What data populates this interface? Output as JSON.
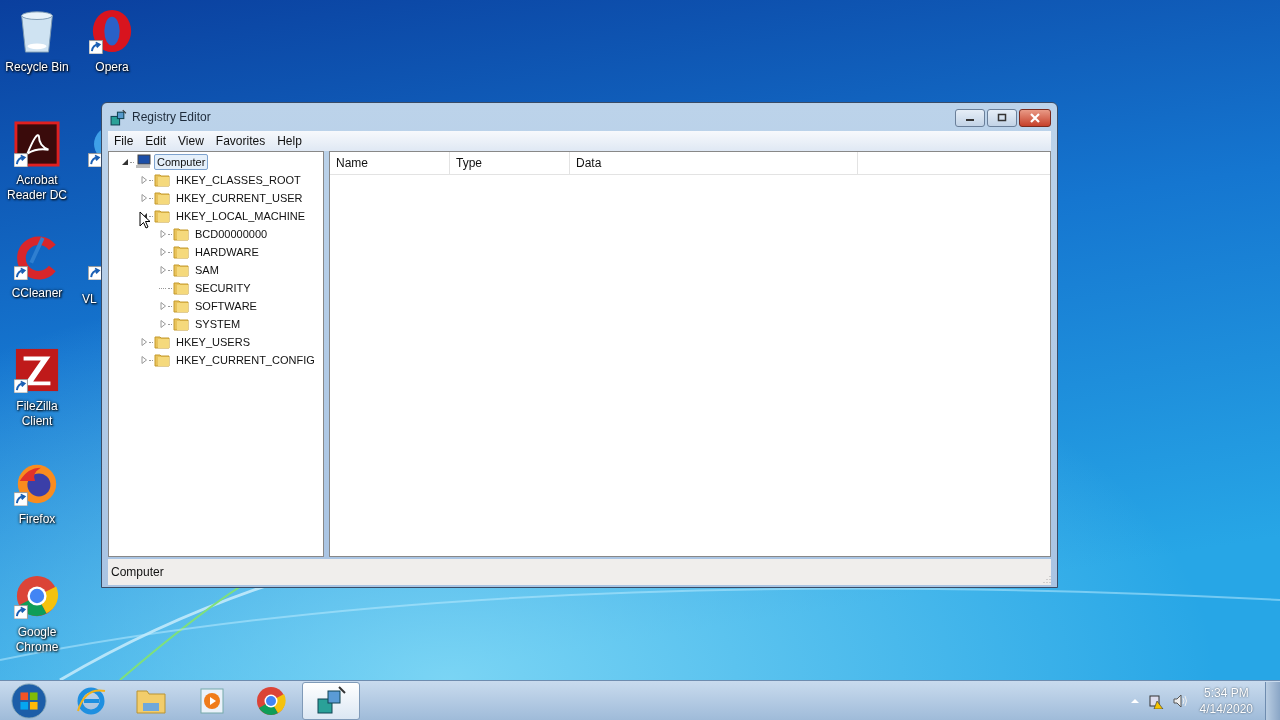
{
  "desktop_icons": [
    {
      "label": "Recycle Bin",
      "kind": "recycle-bin",
      "shortcut": false,
      "partial": false
    },
    {
      "label": "Acrobat Reader DC",
      "kind": "acrobat",
      "shortcut": true,
      "partial": false
    },
    {
      "label": "CCleaner",
      "kind": "ccleaner",
      "shortcut": true,
      "partial": false
    },
    {
      "label": "FileZilla Client",
      "kind": "filezilla",
      "shortcut": true,
      "partial": false
    },
    {
      "label": "Firefox",
      "kind": "firefox",
      "shortcut": true,
      "partial": false
    },
    {
      "label": "Google Chrome",
      "kind": "chrome",
      "shortcut": true,
      "partial": false
    },
    {
      "label": "Opera",
      "kind": "opera",
      "shortcut": true,
      "partial": false
    },
    {
      "kind": "generic",
      "shortcut": true,
      "partial": true
    },
    {
      "label": "VL",
      "kind": "vlc",
      "shortcut": true,
      "partial": true
    }
  ],
  "window": {
    "title": "Registry Editor",
    "menu": [
      "File",
      "Edit",
      "View",
      "Favorites",
      "Help"
    ],
    "tree": [
      {
        "label": "Computer",
        "kind": "computer",
        "has_children": true,
        "expanded": true,
        "selected": true,
        "children": [
          {
            "label": "HKEY_CLASSES_ROOT",
            "kind": "folder",
            "has_children": true,
            "expanded": false,
            "selected": false
          },
          {
            "label": "HKEY_CURRENT_USER",
            "kind": "folder",
            "has_children": true,
            "expanded": false,
            "selected": false
          },
          {
            "label": "HKEY_LOCAL_MACHINE",
            "kind": "folder",
            "has_children": true,
            "expanded": true,
            "selected": false,
            "children": [
              {
                "label": "BCD00000000",
                "kind": "folder",
                "has_children": true,
                "expanded": false,
                "selected": false
              },
              {
                "label": "HARDWARE",
                "kind": "folder",
                "has_children": true,
                "expanded": false,
                "selected": false
              },
              {
                "label": "SAM",
                "kind": "folder",
                "has_children": true,
                "expanded": false,
                "selected": false
              },
              {
                "label": "SECURITY",
                "kind": "folder",
                "has_children": false,
                "expanded": false,
                "selected": false
              },
              {
                "label": "SOFTWARE",
                "kind": "folder",
                "has_children": true,
                "expanded": false,
                "selected": false
              },
              {
                "label": "SYSTEM",
                "kind": "folder",
                "has_children": true,
                "expanded": false,
                "selected": false
              }
            ]
          },
          {
            "label": "HKEY_USERS",
            "kind": "folder",
            "has_children": true,
            "expanded": false,
            "selected": false
          },
          {
            "label": "HKEY_CURRENT_CONFIG",
            "kind": "folder",
            "has_children": true,
            "expanded": false,
            "selected": false
          }
        ]
      }
    ],
    "columns": [
      "Name",
      "Type",
      "Data"
    ],
    "status_bar": "Computer"
  },
  "taskbar": {
    "apps": [
      {
        "kind": "ie",
        "active": false
      },
      {
        "kind": "explorer",
        "active": false
      },
      {
        "kind": "media-player",
        "active": false
      },
      {
        "kind": "chrome",
        "active": false
      },
      {
        "kind": "regedit",
        "active": true
      }
    ],
    "clock": {
      "time": "5:34 PM",
      "date": "4/14/2020"
    }
  }
}
